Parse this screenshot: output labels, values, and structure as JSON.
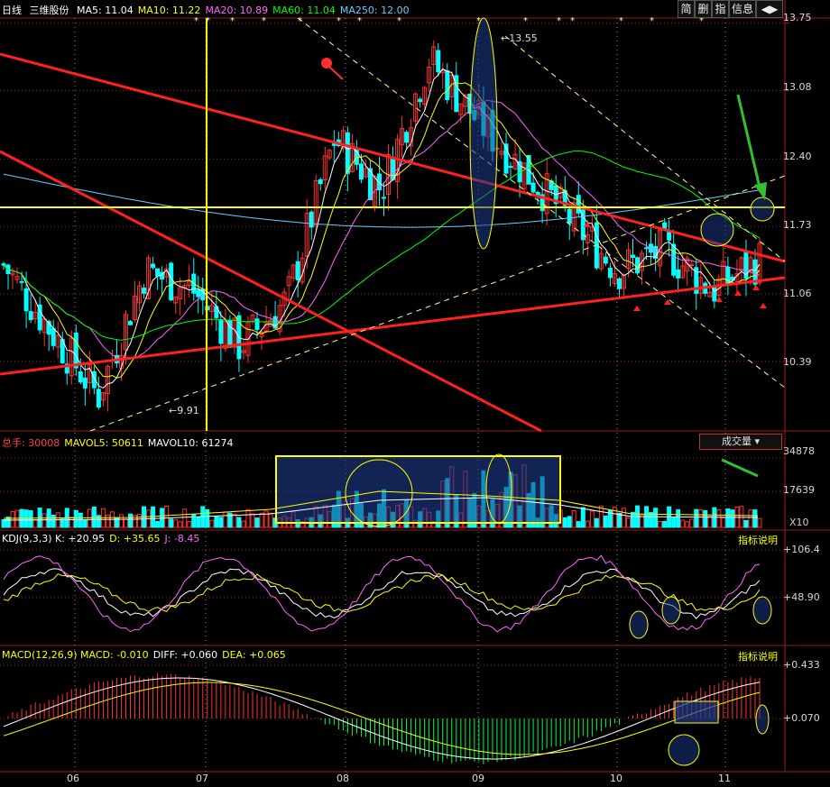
{
  "toolbar": {
    "period": "日线",
    "stock_name": "三维股份",
    "buttons": [
      "简",
      "删",
      "指",
      "信息"
    ],
    "nav_icon": "arrow-left-right-icon"
  },
  "ma_header": [
    {
      "label": "MA5: 11.04",
      "color": "#ffffff"
    },
    {
      "label": "MA10: 11.22",
      "color": "#ffff00"
    },
    {
      "label": "MA20: 10.89",
      "color": "#ff66ff"
    },
    {
      "label": "MA60: 11.04",
      "color": "#00ff00"
    },
    {
      "label": "MA250: 12.00",
      "color": "#66ccff"
    }
  ],
  "vol_header": [
    {
      "label": "总手: 30008",
      "color": "#ff4040"
    },
    {
      "label": "MAVOL5: 50611",
      "color": "#ffff00"
    },
    {
      "label": "MAVOL10: 61274",
      "color": "#ffffff"
    }
  ],
  "vol_button": "成交量 ▾",
  "vol_unit": "X10",
  "kdj_header": [
    {
      "label": "KDJ(9,3,3) K: +20.95",
      "color": "#ffffff"
    },
    {
      "label": "D: +35.65",
      "color": "#ffff00"
    },
    {
      "label": "J: -8.45",
      "color": "#ff66ff"
    }
  ],
  "macd_header": [
    {
      "label": "MACD(12,26,9) MACD: -0.010",
      "color": "#ffff00"
    },
    {
      "label": "DIFF: +0.060",
      "color": "#ffffff"
    },
    {
      "label": "DEA: +0.065",
      "color": "#ffff00"
    }
  ],
  "indicator_help": "指标说明",
  "price_axis": [
    "13.75",
    "13.08",
    "12.40",
    "11.73",
    "11.06",
    "10.39"
  ],
  "vol_axis": [
    "34878",
    "17639"
  ],
  "kdj_axis": [
    "+106.4",
    "+48.90"
  ],
  "macd_axis": [
    "+0.433",
    "+0.070"
  ],
  "x_axis": [
    "06",
    "07",
    "08",
    "09",
    "10",
    "11"
  ],
  "high_marker": "13.55",
  "low_marker": "9.91",
  "colors": {
    "up": "#ff3030",
    "down": "#00ffff",
    "grid": "#a01818",
    "bg": "#000000"
  },
  "chart_data": [
    {
      "type": "candlestick",
      "title": "三维股份 日线",
      "period": "daily",
      "y_axis_ticks": [
        13.75,
        13.08,
        12.4,
        11.73,
        11.06,
        10.39
      ],
      "ylim": [
        9.7,
        13.8
      ],
      "x_months": [
        "06",
        "07",
        "08",
        "09",
        "10",
        "11"
      ],
      "annotated_high": 13.55,
      "annotated_low": 9.91,
      "ma_latest": {
        "MA5": 11.04,
        "MA10": 11.22,
        "MA20": 10.89,
        "MA60": 11.04,
        "MA250": 12.0
      },
      "key_points": [
        {
          "phase": "early-06",
          "close": 11.35
        },
        {
          "phase": "mid-06",
          "close": 10.7
        },
        {
          "phase": "late-06",
          "close": 10.05
        },
        {
          "phase": "early-07",
          "close": 11.3
        },
        {
          "phase": "mid-07",
          "close": 11.1
        },
        {
          "phase": "late-07",
          "close": 10.55
        },
        {
          "phase": "early-08",
          "close": 11.0
        },
        {
          "phase": "mid-08",
          "close": 12.6
        },
        {
          "phase": "late-08",
          "close": 12.1
        },
        {
          "phase": "early-09",
          "close": 13.4
        },
        {
          "phase": "mid-09",
          "close": 12.8
        },
        {
          "phase": "late-09",
          "close": 12.3
        },
        {
          "phase": "early-10",
          "close": 11.8
        },
        {
          "phase": "mid-10",
          "close": 11.3
        },
        {
          "phase": "late-10",
          "close": 11.5
        },
        {
          "phase": "early-11",
          "close": 11.1
        },
        {
          "phase": "latest",
          "close": 11.4
        }
      ]
    },
    {
      "type": "bar",
      "title": "成交量",
      "y_axis_ticks": [
        34878,
        17639
      ],
      "unit_multiplier": 10,
      "latest": {
        "volume": 30008,
        "MAVOL5": 50611,
        "MAVOL10": 61274
      }
    },
    {
      "type": "line",
      "title": "KDJ(9,3,3)",
      "y_axis_ticks": [
        106.4,
        48.9
      ],
      "latest": {
        "K": 20.95,
        "D": 35.65,
        "J": -8.45
      }
    },
    {
      "type": "bar",
      "title": "MACD(12,26,9)",
      "y_axis_ticks": [
        0.433,
        0.07
      ],
      "latest": {
        "MACD": -0.01,
        "DIFF": 0.06,
        "DEA": 0.065
      }
    }
  ]
}
